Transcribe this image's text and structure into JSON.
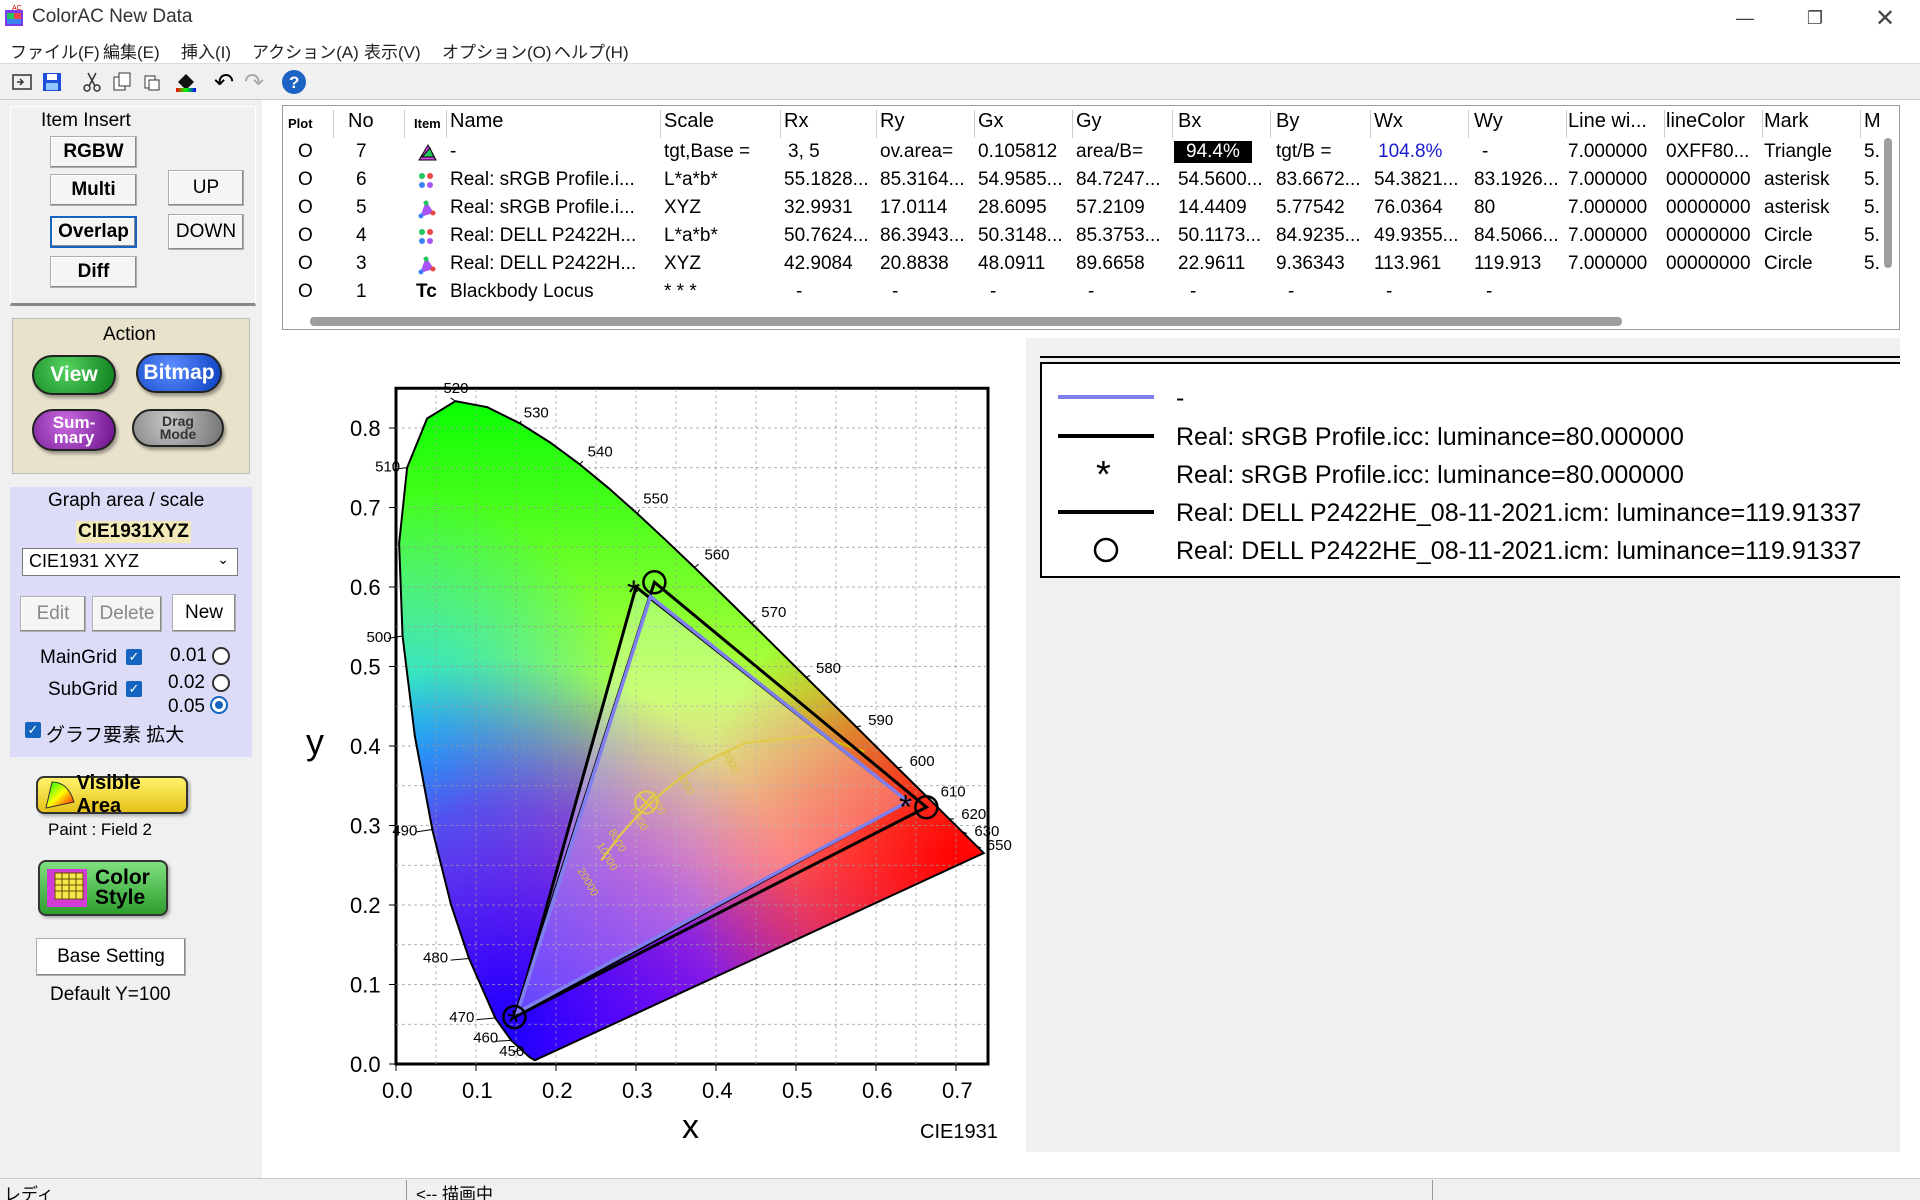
{
  "window": {
    "title": "ColorAC  New Data"
  },
  "menu": [
    "ファイル(F)",
    "編集(E)",
    "挿入(I)",
    "アクション(A)",
    "表示(V)",
    "オプション(O)",
    "ヘルプ(H)"
  ],
  "toolbar": [
    "open-icon",
    "save-icon",
    "cut-icon",
    "copy-icon",
    "paste-icon",
    "paint-icon",
    "undo-icon",
    "redo-icon",
    "help-icon"
  ],
  "left": {
    "item_insert": "Item Insert",
    "rgbw": "RGBW",
    "multi": "Multi",
    "overlap": "Overlap",
    "diff": "Diff",
    "up": "UP",
    "down": "DOWN",
    "action": "Action",
    "view": "View",
    "bitmap": "Bitmap",
    "summary": "Sum-\nmary",
    "drag_mode": "Drag\nMode",
    "graph_area": "Graph area / scale",
    "scale_name": "CIE1931XYZ",
    "scale_select": "CIE1931 XYZ",
    "edit": "Edit",
    "delete": "Delete",
    "new": "New",
    "maingrid": "MainGrid",
    "subgrid": "SubGrid",
    "r1": "0.01",
    "r2": "0.02",
    "r3": "0.05",
    "enlarge": "グラフ要素 拡大",
    "visible_area": "Visible Area",
    "paint": "Paint  : Field 2",
    "color_style": "Color\nStyle",
    "base_setting": "Base Setting",
    "default_y": "Default Y=100"
  },
  "table": {
    "headers": [
      "Plot",
      "No",
      "Item",
      "Name",
      "Scale",
      "Rx",
      "Ry",
      "Gx",
      "Gy",
      "Bx",
      "By",
      "Wx",
      "Wy",
      "Line wi...",
      "lineColor",
      "Mark",
      "M"
    ],
    "rows": [
      [
        "O",
        "7",
        "",
        "-",
        "tgt,Base =",
        "3, 5",
        "ov.area=",
        "0.105812",
        "area/B=",
        "94.4%",
        "tgt/B =",
        "104.8%",
        "-",
        "7.000000",
        "0XFF80...",
        "Triangle",
        "5."
      ],
      [
        "O",
        "6",
        "",
        "Real: sRGB Profile.i...",
        "L*a*b*",
        "55.1828...",
        "85.3164...",
        "54.9585...",
        "84.7247...",
        "54.5600...",
        "83.6672...",
        "54.3821...",
        "83.1926...",
        "7.000000",
        "00000000",
        "asterisk",
        "5."
      ],
      [
        "O",
        "5",
        "",
        "Real: sRGB Profile.i...",
        "XYZ",
        "32.9931",
        "17.0114",
        "28.6095",
        "57.2109",
        "14.4409",
        "5.77542",
        "76.0364",
        "80",
        "7.000000",
        "00000000",
        "asterisk",
        "5."
      ],
      [
        "O",
        "4",
        "",
        "Real: DELL P2422H...",
        "L*a*b*",
        "50.7624...",
        "86.3943...",
        "50.3148...",
        "85.3753...",
        "50.1173...",
        "84.9235...",
        "49.9355...",
        "84.5066...",
        "7.000000",
        "00000000",
        "Circle",
        "5."
      ],
      [
        "O",
        "3",
        "",
        "Real: DELL P2422H...",
        "XYZ",
        "42.9084",
        "20.8838",
        "48.0911",
        "89.6658",
        "22.9611",
        "9.36343",
        "113.961",
        "119.913",
        "7.000000",
        "00000000",
        "Circle",
        "5."
      ],
      [
        "O",
        "1",
        "Tc",
        "Blackbody Locus",
        " * * *",
        "-",
        "-",
        "-",
        "-",
        "-",
        "-",
        "-",
        "-",
        "",
        "",
        "",
        ""
      ]
    ]
  },
  "chart": {
    "ylabel": "y",
    "xlabel": "x",
    "footer": "CIE1931",
    "xticks": [
      "0.0",
      "0.1",
      "0.2",
      "0.3",
      "0.4",
      "0.5",
      "0.6",
      "0.7"
    ],
    "yticks": [
      "0.0",
      "0.1",
      "0.2",
      "0.3",
      "0.4",
      "0.5",
      "0.6",
      "0.7",
      "0.8"
    ],
    "wavelengths": [
      "450",
      "460",
      "470",
      "480",
      "490",
      "500",
      "510",
      "520",
      "530",
      "540",
      "550",
      "560",
      "570",
      "580",
      "590",
      "600",
      "610",
      "620",
      "630",
      "650"
    ],
    "cct_labels": [
      "3000",
      "4000",
      "5000",
      "6000",
      "8000",
      "10000",
      "20000"
    ]
  },
  "legend": [
    {
      "label": "-",
      "marker": "line-blue"
    },
    {
      "label": "Real: sRGB Profile.icc: luminance=80.000000",
      "marker": "line"
    },
    {
      "label": "Real: sRGB Profile.icc: luminance=80.000000",
      "marker": "asterisk"
    },
    {
      "label": "Real: DELL P2422HE_08-11-2021.icm: luminance=119.91337",
      "marker": "line"
    },
    {
      "label": "Real: DELL P2422HE_08-11-2021.icm: luminance=119.91337",
      "marker": "circle"
    }
  ],
  "status": {
    "left": "レディ",
    "mid": "<-- 描画中"
  },
  "colors": {
    "accent": "#1565c0",
    "view": "#1a9a2a",
    "bitmap": "#1b4fd6",
    "summary": "#8e24aa",
    "drag": "#8a8a8a",
    "highlight_black": "#000000",
    "blue_text": "#1a1acc"
  }
}
